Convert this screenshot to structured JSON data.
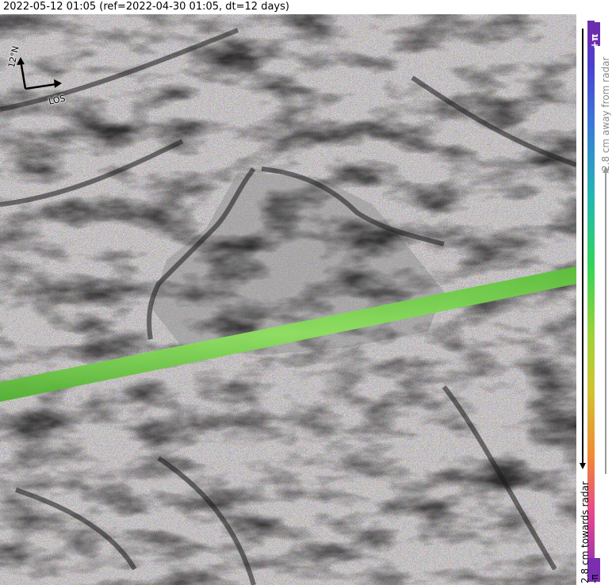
{
  "header": {
    "title": "2022-05-12 01:05 (ref=2022-04-30 01:05, dt=12 days)"
  },
  "compass": {
    "north_label": "12°N",
    "los_label": "LOS"
  },
  "colorbar": {
    "top_label": "+π",
    "bottom_label": "-π",
    "away_label": "2.8 cm away from radar",
    "towards_label": "2.8 cm towards radar",
    "colors": [
      "#6a2fb0",
      "#3a78d8",
      "#22b9b0",
      "#35d35a",
      "#d0c430",
      "#f08a35",
      "#e8488a",
      "#8a2fb5"
    ]
  },
  "map": {
    "overlay_band_color": "#7ed957"
  }
}
